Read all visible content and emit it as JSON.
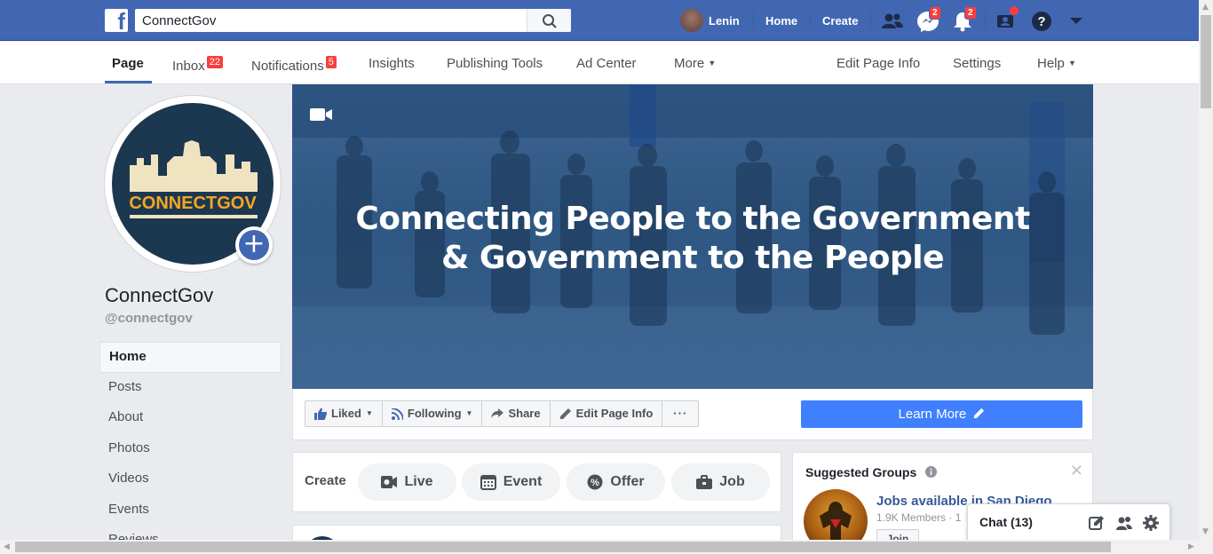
{
  "topbar": {
    "search_value": "ConnectGov",
    "user_name": "Lenin",
    "home": "Home",
    "create": "Create",
    "messenger_count": "2",
    "notif_count": "2"
  },
  "subnav": {
    "page": "Page",
    "inbox": "Inbox",
    "inbox_count": "22",
    "notifications": "Notifications",
    "notifications_count": "5",
    "insights": "Insights",
    "publishing_tools": "Publishing Tools",
    "ad_center": "Ad Center",
    "more": "More",
    "edit_page_info": "Edit Page Info",
    "settings": "Settings",
    "help": "Help"
  },
  "profile": {
    "logo_text": "CONNECTGOV",
    "name": "ConnectGov",
    "handle": "@connectgov"
  },
  "leftnav": [
    "Home",
    "Posts",
    "About",
    "Photos",
    "Videos",
    "Events",
    "Reviews"
  ],
  "cover": {
    "line1": "Connecting People to the Government",
    "line2": "& Government to the People"
  },
  "actions": {
    "liked": "Liked",
    "following": "Following",
    "share": "Share",
    "edit_page_info": "Edit Page Info",
    "more": "···",
    "learn_more": "Learn More"
  },
  "create": {
    "label": "Create",
    "live": "Live",
    "event": "Event",
    "offer": "Offer",
    "job": "Job"
  },
  "suggested": {
    "title": "Suggested Groups",
    "group_name": "Jobs available in San Diego",
    "group_meta": "1.9K Members · 1",
    "join": "Join"
  },
  "chat": {
    "label": "Chat (13)"
  },
  "colors": {
    "brand": "#4267b2",
    "accent": "#4080ff",
    "badge": "#fa3e3e"
  }
}
